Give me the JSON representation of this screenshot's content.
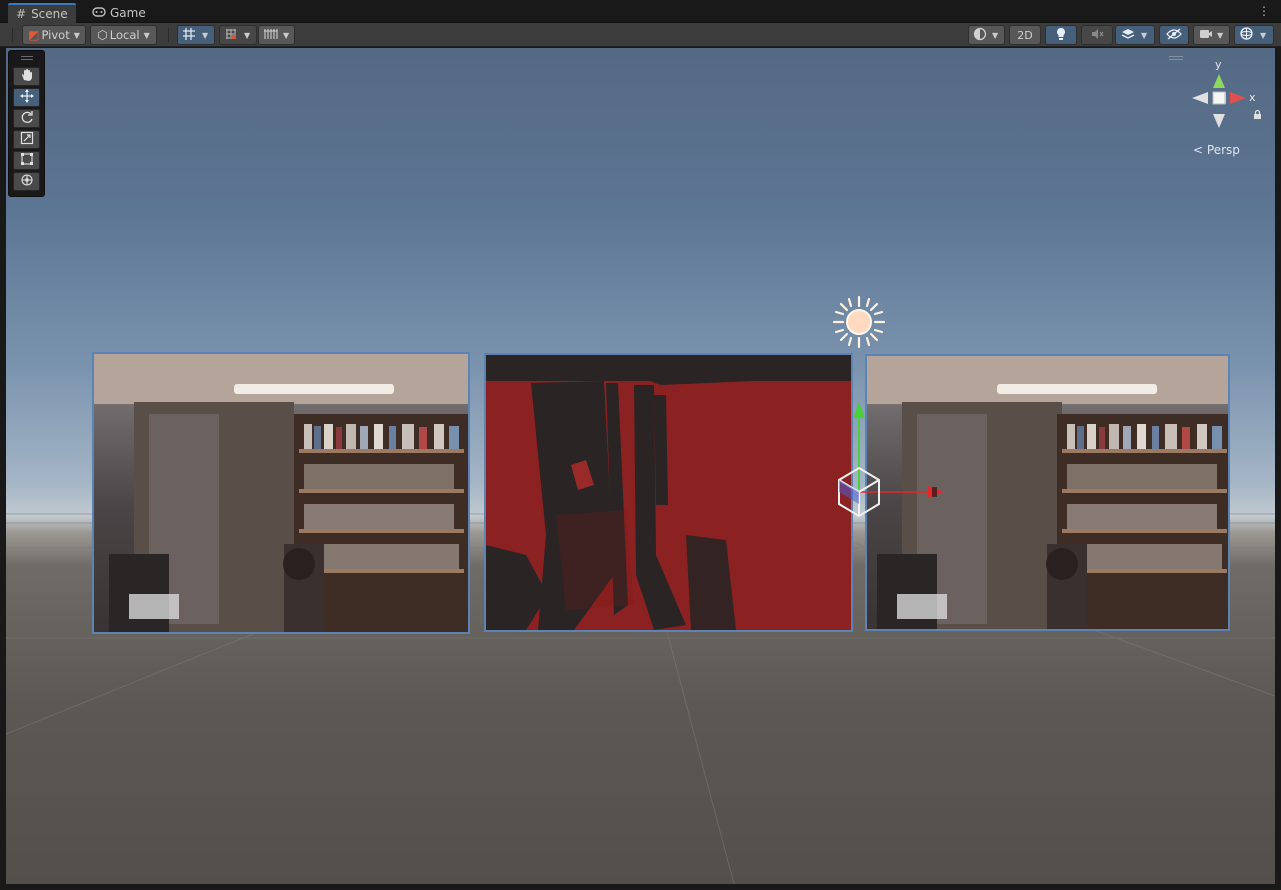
{
  "tabs": [
    {
      "label": "Scene",
      "icon": "hash-icon",
      "active": true
    },
    {
      "label": "Game",
      "icon": "gamepad-icon",
      "active": false
    }
  ],
  "toolbar": {
    "pivot_label": "Pivot",
    "local_label": "Local",
    "mode_2d_label": "2D"
  },
  "gizmo": {
    "y_label": "y",
    "x_label": "x",
    "projection_label": "Persp"
  },
  "colors": {
    "accent": "#46607c",
    "tab_highlight": "#3a79bb",
    "panel_border": "#5d83b4",
    "depth_red": "#8a1f1f",
    "axis_x": "#e03030",
    "axis_y": "#60d040"
  }
}
